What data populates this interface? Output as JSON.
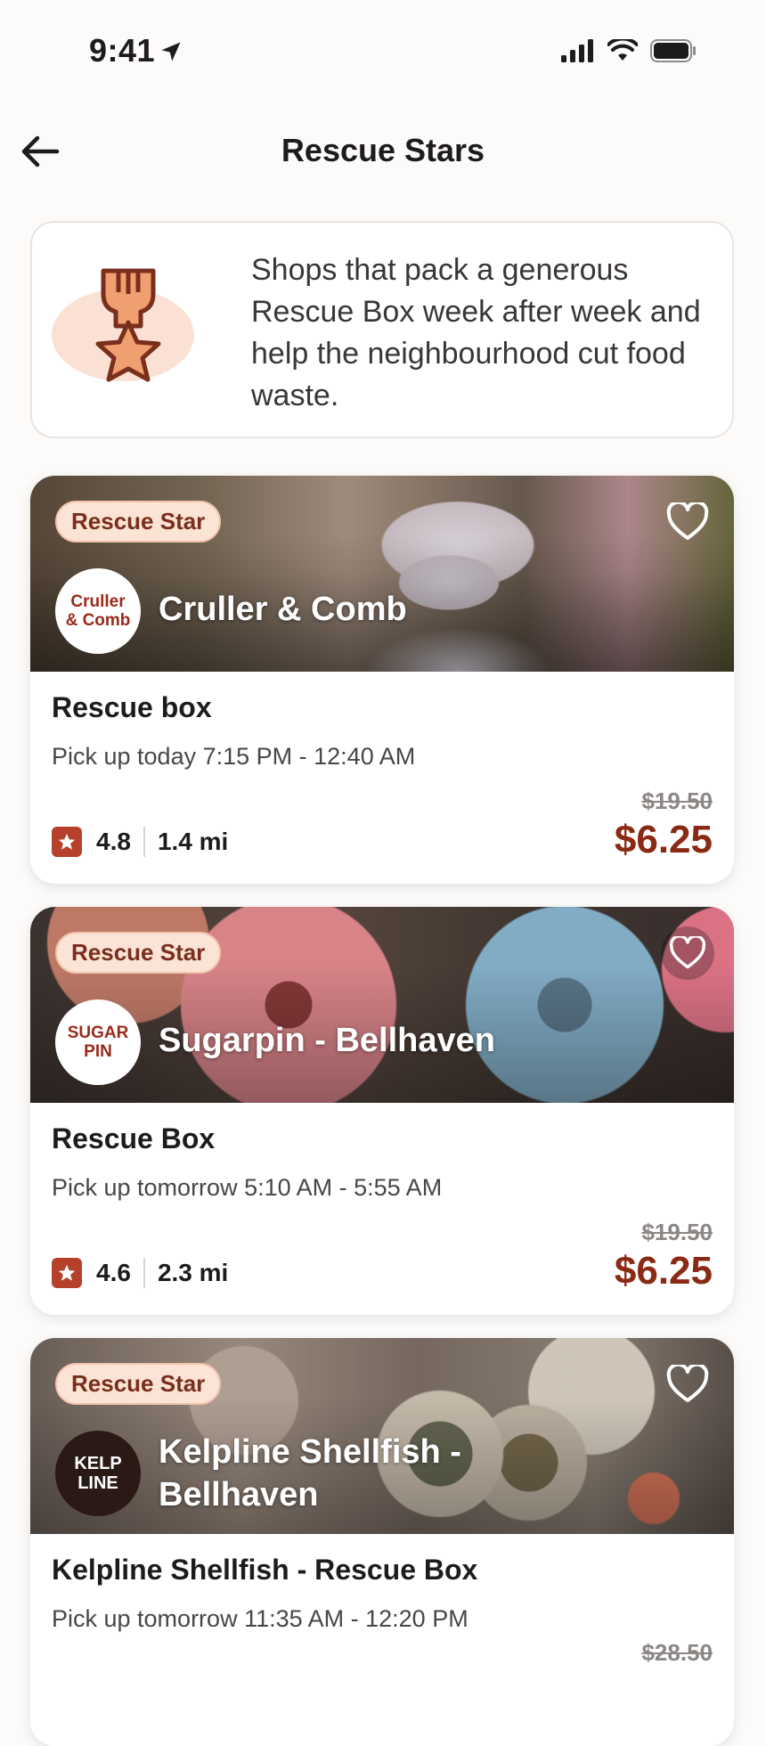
{
  "status_bar": {
    "time": "9:41"
  },
  "header": {
    "title": "Rescue Stars"
  },
  "info": {
    "text": "Shops that pack a generous Rescue Box week after week and help the neighbourhood cut food waste."
  },
  "cards": [
    {
      "badge": "Rescue Star",
      "logo_text": "Cruller\n& Comb",
      "store_name": "Cruller & Comb",
      "box_title": "Rescue box",
      "pickup": "Pick up today 7:15 PM - 12:40 AM",
      "rating": "4.8",
      "distance": "1.4 mi",
      "old_price": "$19.50",
      "price": "$6.25"
    },
    {
      "badge": "Rescue Star",
      "logo_text": "SUGAR\nPIN",
      "store_name": "Sugarpin - Bellhaven",
      "box_title": "Rescue Box",
      "pickup": "Pick up tomorrow 5:10 AM - 5:55 AM",
      "rating": "4.6",
      "distance": "2.3 mi",
      "old_price": "$19.50",
      "price": "$6.25"
    },
    {
      "badge": "Rescue Star",
      "logo_text": "KELP\nLINE",
      "store_name": "Kelpline Shellfish - Bellhaven",
      "box_title": "Kelpline Shellfish - Rescue Box",
      "pickup": "Pick up tomorrow 11:35 AM - 12:20 PM",
      "old_price": "$28.50"
    }
  ],
  "colors": {
    "accent": "#8a2a14",
    "badge_bg": "#fbe3d6",
    "rating_icon": "#b5412b",
    "background": "#fdfbf9"
  },
  "icons": [
    "location-arrow-icon",
    "signal-icon",
    "wifi-icon",
    "battery-icon",
    "back-arrow-icon",
    "medal-star-icon",
    "heart-icon",
    "star-icon"
  ]
}
